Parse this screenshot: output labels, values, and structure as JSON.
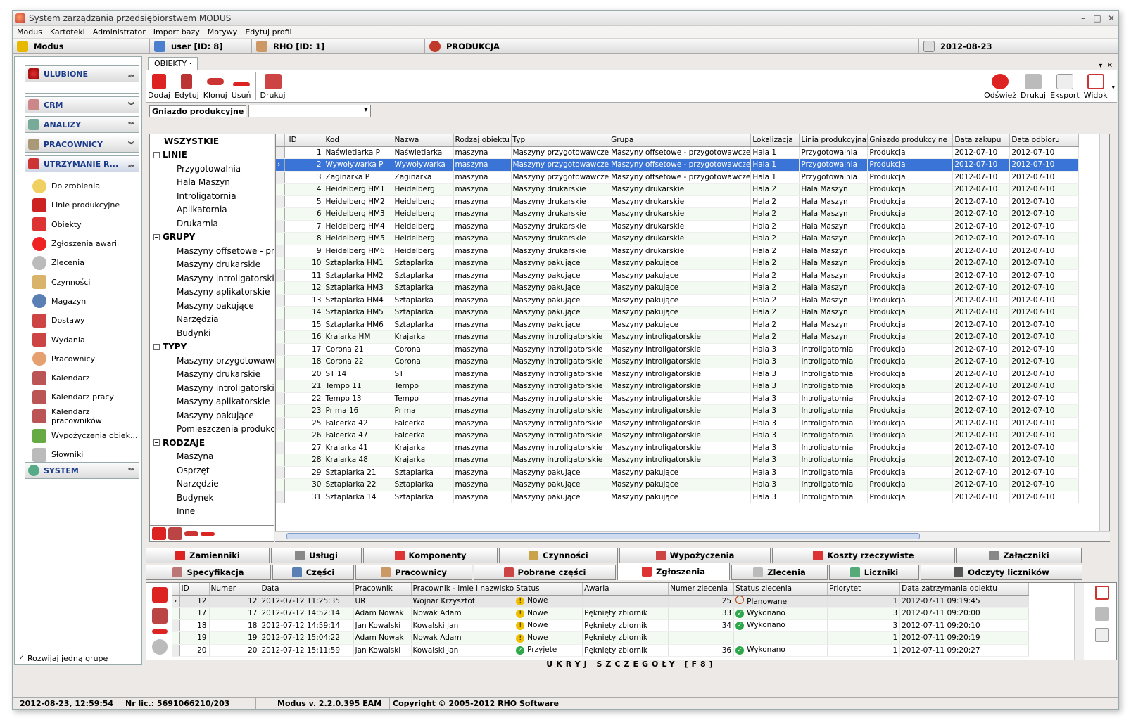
{
  "window": {
    "title": "System zarządzania przedsiębiorstwem MODUS"
  },
  "menubar": [
    "Modus",
    "Kartoteki",
    "Administrator",
    "Import bazy",
    "Motywy",
    "Edytuj profil"
  ],
  "infobar": {
    "app": "Modus",
    "user": "user [ID: 8]",
    "company": "RHO [ID: 1]",
    "module": "PRODUKCJA",
    "date": "2012-08-23"
  },
  "sidebar": {
    "groups": [
      {
        "label": "ULUBIONE"
      },
      {
        "label": "CRM"
      },
      {
        "label": "ANALIZY"
      },
      {
        "label": "PRACOWNICY"
      },
      {
        "label": "UTRZYMANIE R..."
      }
    ],
    "items": [
      "Do zrobienia",
      "Linie produkcyjne",
      "Obiekty",
      "Zgłoszenia awarii",
      "Zlecenia",
      "Czynności",
      "Magazyn",
      "Dostawy",
      "Wydania",
      "Pracownicy",
      "Kalendarz",
      "Kalendarz pracy",
      "Kalendarz pracowników",
      "Wypożyczenia obiek...",
      "Słowniki"
    ],
    "system": "SYSTEM",
    "expand_label": "Rozwijaj jedną grupę",
    "expand_checked": "✓"
  },
  "tab": {
    "label": "OBIEKTY"
  },
  "toolbar": {
    "left": [
      "Dodaj",
      "Edytuj",
      "Klonuj",
      "Usuń",
      "Drukuj"
    ],
    "right": [
      "Odśwież",
      "Drukuj",
      "Eksport",
      "Widok"
    ]
  },
  "filter": {
    "label": "Gniazdo produkcyjne",
    "value": ""
  },
  "tree": {
    "root": "WSZYSTKIE",
    "categories": [
      {
        "label": "LINIE",
        "items": [
          "Przygotowalnia",
          "Hala Maszyn",
          "Introligatornia",
          "Aplikatornia",
          "Drukarnia"
        ]
      },
      {
        "label": "GRUPY",
        "items": [
          "Maszyny offsetowe - prz",
          "Maszyny drukarskie",
          "Maszyny introligatorskie",
          "Maszyny aplikatorskie",
          "Maszyny pakujące",
          "Narzędzia",
          "Budynki"
        ]
      },
      {
        "label": "TYPY",
        "items": [
          "Maszyny przygotowawcz",
          "Maszyny drukarskie",
          "Maszyny introligatorskie",
          "Maszyny aplikatorskie",
          "Maszyny pakujące",
          "Pomieszczenia produkcy"
        ]
      },
      {
        "label": "RODZAJE",
        "items": [
          "Maszyna",
          "Osprzęt",
          "Narzędzie",
          "Budynek",
          "Inne"
        ]
      }
    ],
    "collapse_glyph": "−"
  },
  "grid": {
    "columns": [
      "ID",
      "Kod",
      "Nazwa",
      "Rodzaj obiektu",
      "Typ",
      "Grupa",
      "Lokalizacja",
      "Linia produkcyjna",
      "Gniazdo produkcyjne",
      "Data zakupu",
      "Data odbioru"
    ],
    "selected_index": 1,
    "rows": [
      [
        "1",
        "Naświetlarka P",
        "Naświetlarka",
        "maszyna",
        "Maszyny przygotowawcze",
        "Maszyny offsetowe - przygotowawcze",
        "Hala 1",
        "Przygotowalnia",
        "Produkcja",
        "2012-07-10",
        "2012-07-10"
      ],
      [
        "2",
        "Wywoływarka P",
        "Wywoływarka",
        "maszyna",
        "Maszyny przygotowawcze",
        "Maszyny offsetowe - przygotowawcze",
        "Hala 1",
        "Przygotowalnia",
        "Produkcja",
        "2012-07-10",
        "2012-07-10"
      ],
      [
        "3",
        "Zaginarka P",
        "Zaginarka",
        "maszyna",
        "Maszyny przygotowawcze",
        "Maszyny offsetowe - przygotowawcze",
        "Hala 1",
        "Przygotowalnia",
        "Produkcja",
        "2012-07-10",
        "2012-07-10"
      ],
      [
        "4",
        "Heidelberg HM1",
        "Heidelberg",
        "maszyna",
        "Maszyny drukarskie",
        "Maszyny drukarskie",
        "Hala 2",
        "Hala Maszyn",
        "Produkcja",
        "2012-07-10",
        "2012-07-10"
      ],
      [
        "5",
        "Heidelberg HM2",
        "Heidelberg",
        "maszyna",
        "Maszyny drukarskie",
        "Maszyny drukarskie",
        "Hala 2",
        "Hala Maszyn",
        "Produkcja",
        "2012-07-10",
        "2012-07-10"
      ],
      [
        "6",
        "Heidelberg HM3",
        "Heidelberg",
        "maszyna",
        "Maszyny drukarskie",
        "Maszyny drukarskie",
        "Hala 2",
        "Hala Maszyn",
        "Produkcja",
        "2012-07-10",
        "2012-07-10"
      ],
      [
        "7",
        "Heidelberg HM4",
        "Heidelberg",
        "maszyna",
        "Maszyny drukarskie",
        "Maszyny drukarskie",
        "Hala 2",
        "Hala Maszyn",
        "Produkcja",
        "2012-07-10",
        "2012-07-10"
      ],
      [
        "8",
        "Heidelberg HM5",
        "Heidelberg",
        "maszyna",
        "Maszyny drukarskie",
        "Maszyny drukarskie",
        "Hala 2",
        "Hala Maszyn",
        "Produkcja",
        "2012-07-10",
        "2012-07-10"
      ],
      [
        "9",
        "Heidelberg HM6",
        "Heidelberg",
        "maszyna",
        "Maszyny drukarskie",
        "Maszyny drukarskie",
        "Hala 2",
        "Hala Maszyn",
        "Produkcja",
        "2012-07-10",
        "2012-07-10"
      ],
      [
        "10",
        "Sztaplarka HM1",
        "Sztaplarka",
        "maszyna",
        "Maszyny pakujące",
        "Maszyny pakujące",
        "Hala 2",
        "Hala Maszyn",
        "Produkcja",
        "2012-07-10",
        "2012-07-10"
      ],
      [
        "11",
        "Sztaplarka HM2",
        "Sztaplarka",
        "maszyna",
        "Maszyny pakujące",
        "Maszyny pakujące",
        "Hala 2",
        "Hala Maszyn",
        "Produkcja",
        "2012-07-10",
        "2012-07-10"
      ],
      [
        "12",
        "Sztaplarka HM3",
        "Sztaplarka",
        "maszyna",
        "Maszyny pakujące",
        "Maszyny pakujące",
        "Hala 2",
        "Hala Maszyn",
        "Produkcja",
        "2012-07-10",
        "2012-07-10"
      ],
      [
        "13",
        "Sztaplarka HM4",
        "Sztaplarka",
        "maszyna",
        "Maszyny pakujące",
        "Maszyny pakujące",
        "Hala 2",
        "Hala Maszyn",
        "Produkcja",
        "2012-07-10",
        "2012-07-10"
      ],
      [
        "14",
        "Sztaplarka HM5",
        "Sztaplarka",
        "maszyna",
        "Maszyny pakujące",
        "Maszyny pakujące",
        "Hala 2",
        "Hala Maszyn",
        "Produkcja",
        "2012-07-10",
        "2012-07-10"
      ],
      [
        "15",
        "Sztaplarka HM6",
        "Sztaplarka",
        "maszyna",
        "Maszyny pakujące",
        "Maszyny pakujące",
        "Hala 2",
        "Hala Maszyn",
        "Produkcja",
        "2012-07-10",
        "2012-07-10"
      ],
      [
        "16",
        "Krajarka HM",
        "Krajarka",
        "maszyna",
        "Maszyny introligatorskie",
        "Maszyny introligatorskie",
        "Hala 2",
        "Hala Maszyn",
        "Produkcja",
        "2012-07-10",
        "2012-07-10"
      ],
      [
        "17",
        "Corona 21",
        "Corona",
        "maszyna",
        "Maszyny introligatorskie",
        "Maszyny introligatorskie",
        "Hala 3",
        "Introligatornia",
        "Produkcja",
        "2012-07-10",
        "2012-07-10"
      ],
      [
        "18",
        "Corona 22",
        "Corona",
        "maszyna",
        "Maszyny introligatorskie",
        "Maszyny introligatorskie",
        "Hala 3",
        "Introligatornia",
        "Produkcja",
        "2012-07-10",
        "2012-07-10"
      ],
      [
        "20",
        "ST 14",
        "ST",
        "maszyna",
        "Maszyny introligatorskie",
        "Maszyny introligatorskie",
        "Hala 3",
        "Introligatornia",
        "Produkcja",
        "2012-07-10",
        "2012-07-10"
      ],
      [
        "21",
        "Tempo 11",
        "Tempo",
        "maszyna",
        "Maszyny introligatorskie",
        "Maszyny introligatorskie",
        "Hala 3",
        "Introligatornia",
        "Produkcja",
        "2012-07-10",
        "2012-07-10"
      ],
      [
        "22",
        "Tempo 13",
        "Tempo",
        "maszyna",
        "Maszyny introligatorskie",
        "Maszyny introligatorskie",
        "Hala 3",
        "Introligatornia",
        "Produkcja",
        "2012-07-10",
        "2012-07-10"
      ],
      [
        "23",
        "Prima 16",
        "Prima",
        "maszyna",
        "Maszyny introligatorskie",
        "Maszyny introligatorskie",
        "Hala 3",
        "Introligatornia",
        "Produkcja",
        "2012-07-10",
        "2012-07-10"
      ],
      [
        "25",
        "Falcerka 42",
        "Falcerka",
        "maszyna",
        "Maszyny introligatorskie",
        "Maszyny introligatorskie",
        "Hala 3",
        "Introligatornia",
        "Produkcja",
        "2012-07-10",
        "2012-07-10"
      ],
      [
        "26",
        "Falcerka 47",
        "Falcerka",
        "maszyna",
        "Maszyny introligatorskie",
        "Maszyny introligatorskie",
        "Hala 3",
        "Introligatornia",
        "Produkcja",
        "2012-07-10",
        "2012-07-10"
      ],
      [
        "27",
        "Krajarka 41",
        "Krajarka",
        "maszyna",
        "Maszyny introligatorskie",
        "Maszyny introligatorskie",
        "Hala 3",
        "Introligatornia",
        "Produkcja",
        "2012-07-10",
        "2012-07-10"
      ],
      [
        "28",
        "Krajarka 48",
        "Krajarka",
        "maszyna",
        "Maszyny introligatorskie",
        "Maszyny introligatorskie",
        "Hala 3",
        "Introligatornia",
        "Produkcja",
        "2012-07-10",
        "2012-07-10"
      ],
      [
        "29",
        "Sztaplarka 21",
        "Sztaplarka",
        "maszyna",
        "Maszyny pakujące",
        "Maszyny pakujące",
        "Hala 3",
        "Introligatornia",
        "Produkcja",
        "2012-07-10",
        "2012-07-10"
      ],
      [
        "30",
        "Sztaplarka 22",
        "Sztaplarka",
        "maszyna",
        "Maszyny pakujące",
        "Maszyny pakujące",
        "Hala 3",
        "Introligatornia",
        "Produkcja",
        "2012-07-10",
        "2012-07-10"
      ],
      [
        "31",
        "Sztaplarka 14",
        "Sztaplarka",
        "maszyna",
        "Maszyny pakujące",
        "Maszyny pakujące",
        "Hala 3",
        "Introligatornia",
        "Produkcja",
        "2012-07-10",
        "2012-07-10"
      ]
    ]
  },
  "detail_tabs": {
    "row1": [
      "Zamienniki",
      "Usługi",
      "Komponenty",
      "Czynności",
      "Wypożyczenia",
      "Koszty rzeczywiste",
      "Załączniki"
    ],
    "row2": [
      "Specyfikacja",
      "Części",
      "Pracownicy",
      "Pobrane części",
      "Zgłoszenia",
      "Zlecenia",
      "Liczniki",
      "Odczyty liczników"
    ],
    "active": "Zgłoszenia"
  },
  "detail_grid": {
    "columns": [
      "ID",
      "Numer",
      "Data",
      "Pracownik",
      "Pracownik - imie i nazwisko",
      "Status",
      "Awaria",
      "Numer zlecenia",
      "Status zlecenia",
      "Priorytet",
      "Data zatrzymania obiektu"
    ],
    "rows": [
      [
        "12",
        "12",
        "2012-07-12 11:25:35",
        "UR",
        "Wojnar Krzysztof",
        "Nowe",
        "",
        "25",
        "Planowane",
        "1",
        "2012-07-11 09:19:45"
      ],
      [
        "17",
        "17",
        "2012-07-12 14:52:14",
        "Adam Nowak",
        "Nowak Adam",
        "Nowe",
        "Pęknięty zbiornik",
        "33",
        "Wykonano",
        "3",
        "2012-07-11 09:20:00"
      ],
      [
        "18",
        "18",
        "2012-07-12 14:59:14",
        "Jan Kowalski",
        "Kowalski Jan",
        "Nowe",
        "Pęknięty zbiornik",
        "34",
        "Wykonano",
        "3",
        "2012-07-11 09:20:10"
      ],
      [
        "19",
        "19",
        "2012-07-12 15:04:22",
        "Adam Nowak",
        "Nowak Adam",
        "Nowe",
        "Pęknięty zbiornik",
        "",
        "",
        "1",
        "2012-07-11 09:20:19"
      ],
      [
        "20",
        "20",
        "2012-07-12 15:11:59",
        "Jan Kowalski",
        "Kowalski Jan",
        "Przyjęte",
        "Pęknięty zbiornik",
        "36",
        "Wykonano",
        "1",
        "2012-07-11 09:20:27"
      ]
    ]
  },
  "hide_details": "UKRYJ SZCZEGÓŁY [F8]",
  "statusbar": {
    "datetime": "2012-08-23, 12:59:54",
    "license": "Nr lic.: 5691066210/203",
    "version": "Modus v. 2.2.0.395 EAM",
    "copyright": "Copyright © 2005-2012 RHO Software"
  }
}
